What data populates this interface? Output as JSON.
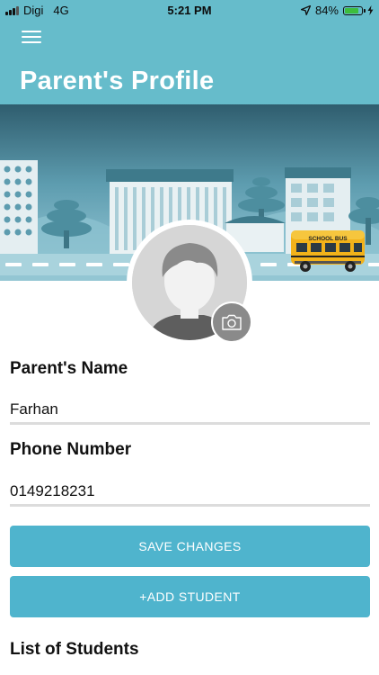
{
  "status_bar": {
    "carrier": "Digi",
    "network": "4G",
    "time": "5:21 PM",
    "battery_percent": "84%",
    "battery_level": 0.84
  },
  "header": {
    "title": "Parent's Profile"
  },
  "banner": {
    "bus_label": "SCHOOL BUS"
  },
  "form": {
    "name_label": "Parent's Name",
    "name_value": "Farhan",
    "phone_label": "Phone Number",
    "phone_value": "0149218231"
  },
  "actions": {
    "save_label": "SAVE CHANGES",
    "add_student_label": "+ADD STUDENT"
  },
  "students": {
    "section_title": "List of Students"
  },
  "colors": {
    "header": "#66bccb",
    "button": "#4fb4cd",
    "battery": "#3dbd3d"
  }
}
